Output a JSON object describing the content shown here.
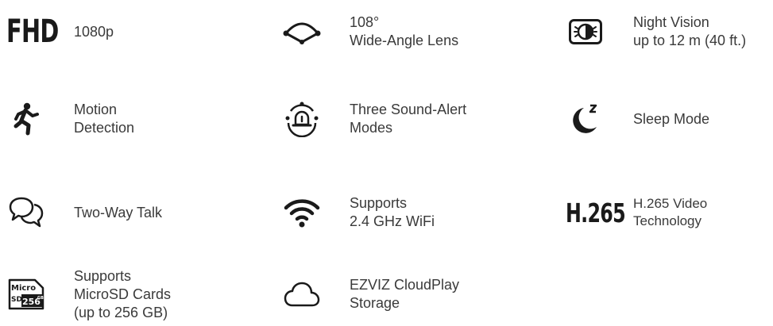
{
  "features": [
    {
      "icon": "fhd-text-icon",
      "icon_text": "FHD",
      "label": "1080p"
    },
    {
      "icon": "wide-angle-lens-icon",
      "label": "108°\nWide-Angle Lens"
    },
    {
      "icon": "night-vision-icon",
      "label": "Night Vision\nup to 12 m (40 ft.)"
    },
    {
      "icon": "running-person-icon",
      "label": "Motion\nDetection"
    },
    {
      "icon": "alarm-siren-icon",
      "label": "Three Sound-Alert\nModes"
    },
    {
      "icon": "moon-sleep-icon",
      "label": "Sleep Mode"
    },
    {
      "icon": "chat-bubbles-icon",
      "label": "Two-Way Talk"
    },
    {
      "icon": "wifi-icon",
      "label": "Supports\n2.4 GHz WiFi"
    },
    {
      "icon": "h265-text-icon",
      "icon_text": "H.265",
      "label": "H.265 Video\nTechnology"
    },
    {
      "icon": "microsd-card-icon",
      "icon_text_top": "Micro",
      "icon_text_bottom_left": "SD",
      "icon_text_bottom_right": "256",
      "icon_text_superscript": "GB",
      "label": "Supports\nMicroSD Cards\n(up to 256 GB)"
    },
    {
      "icon": "cloud-icon",
      "label": "EZVIZ CloudPlay\nStorage"
    }
  ],
  "colors": {
    "icon": "#1a1a1a",
    "text": "#3a3a3a",
    "background": "#ffffff"
  }
}
